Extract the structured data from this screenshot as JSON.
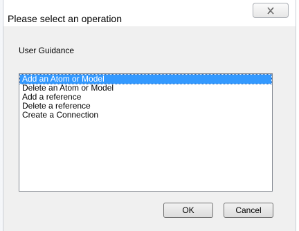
{
  "dialog": {
    "title": "Please select an operation",
    "close_icon": "close-icon"
  },
  "guidance": {
    "label": "User Guidance"
  },
  "operations": {
    "items": [
      {
        "label": "Add an Atom or Model",
        "selected": true
      },
      {
        "label": "Delete an Atom or Model",
        "selected": false
      },
      {
        "label": "Add a reference",
        "selected": false
      },
      {
        "label": "Delete a reference",
        "selected": false
      },
      {
        "label": "Create a Connection",
        "selected": false
      }
    ]
  },
  "buttons": {
    "ok_label": "OK",
    "cancel_label": "Cancel"
  },
  "colors": {
    "selection": "#3399ff",
    "dialog_bg": "#f0f0f0"
  }
}
